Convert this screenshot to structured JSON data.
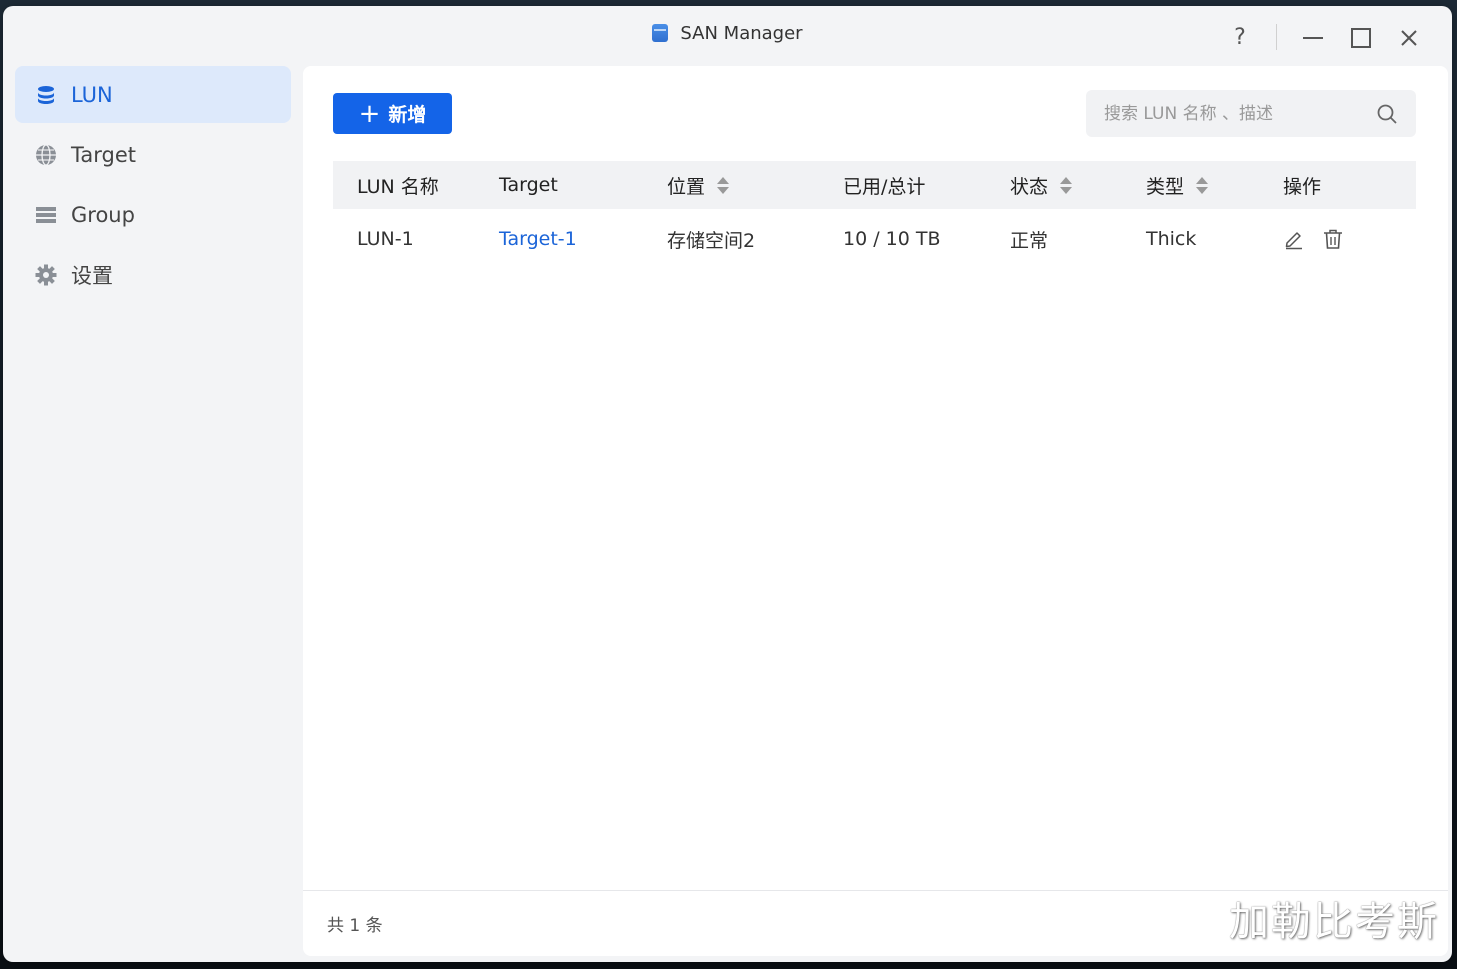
{
  "window": {
    "title": "SAN Manager"
  },
  "titlebar": {
    "help": "?",
    "minimize": "—",
    "maximize": "☐",
    "close": "✕"
  },
  "sidebar": {
    "items": [
      {
        "label": "LUN",
        "icon": "database-icon",
        "active": true
      },
      {
        "label": "Target",
        "icon": "globe-icon",
        "active": false
      },
      {
        "label": "Group",
        "icon": "list-icon",
        "active": false
      },
      {
        "label": "设置",
        "icon": "gear-icon",
        "active": false
      }
    ]
  },
  "toolbar": {
    "add_label": "新增",
    "add_plus": "+"
  },
  "search": {
    "placeholder": "搜索 LUN 名称 、描述"
  },
  "table": {
    "headers": [
      "LUN 名称",
      "Target",
      "位置",
      "已用/总计",
      "状态",
      "类型",
      "操作"
    ],
    "rows": [
      {
        "name": "LUN-1",
        "target": "Target-1",
        "location": "存储空间2",
        "usage": "10 / 10 TB",
        "status": "正常",
        "type": "Thick"
      }
    ]
  },
  "footer": {
    "total": "共 1 条"
  },
  "watermark": "加勒比考斯",
  "colors": {
    "accent": "#1464e8",
    "active_bg": "#dde9fb",
    "link": "#1b64d8"
  }
}
